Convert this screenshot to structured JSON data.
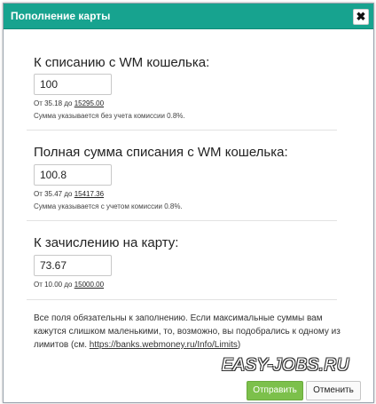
{
  "dialog": {
    "title": "Пополнение карты",
    "close_glyph": "✖"
  },
  "sections": [
    {
      "heading": "К списанию с WM кошелька:",
      "input_value": "100",
      "range_prefix": "От 35.18 до",
      "range_max": "15295.00",
      "note": "Сумма указывается без учета комиссии 0.8%."
    },
    {
      "heading": "Полная сумма списания с WM кошелька:",
      "input_value": "100.8",
      "range_prefix": "От 35.47 до",
      "range_max": "15417.36",
      "note": "Сумма указывается с учетом комиссии 0.8%."
    },
    {
      "heading": "К зачислению на карту:",
      "input_value": "73.67",
      "range_prefix": "От 10.00 до",
      "range_max": "15000.00"
    }
  ],
  "info": {
    "text": "Все поля обязательны к заполнению. Если максимальные суммы вам кажутся слишком маленькими, то, возможно, вы подобрались к одному из лимитов (см.",
    "link": "https://banks.webmoney.ru/Info/Limits",
    "suffix": ")"
  },
  "buttons": {
    "submit": "Отправить",
    "cancel": "Отменить"
  },
  "watermark": "EASY-JOBS.RU",
  "colors": {
    "titlebar": "#17a38f",
    "submit": "#7cc04b"
  }
}
